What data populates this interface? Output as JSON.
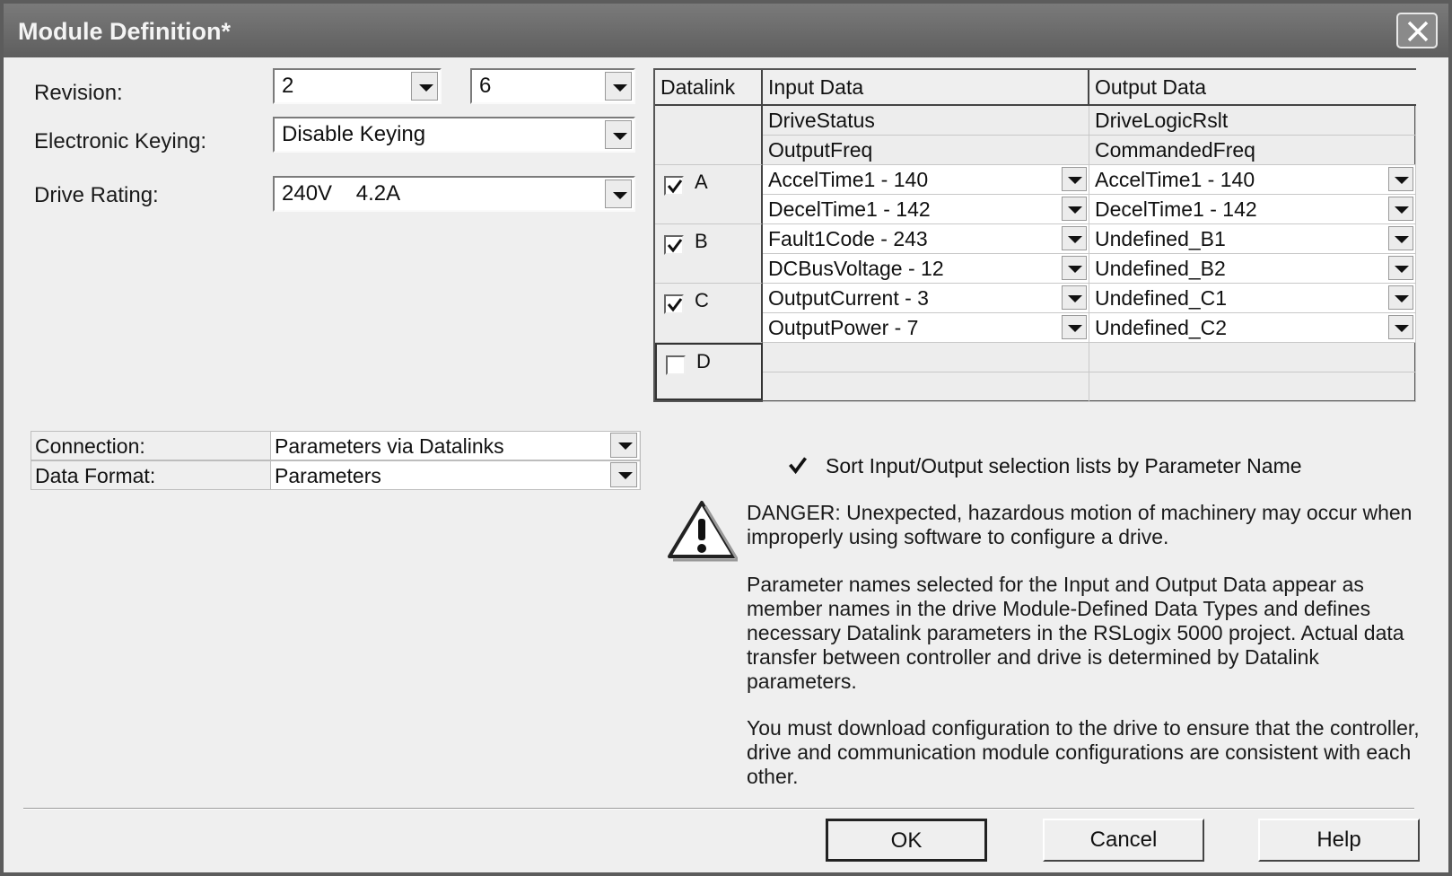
{
  "window": {
    "title": "Module Definition*"
  },
  "revision": {
    "label": "Revision:",
    "major": "2",
    "minor": "6"
  },
  "keying": {
    "label": "Electronic Keying:",
    "value": "Disable Keying"
  },
  "drive_rating": {
    "label": "Drive Rating:",
    "value": "240V    4.2A"
  },
  "grid": {
    "headers": {
      "datalink": "Datalink",
      "input": "Input Data",
      "output": "Output Data"
    },
    "fixed_rows": [
      {
        "input": "DriveStatus",
        "output": "DriveLogicRslt"
      },
      {
        "input": "OutputFreq",
        "output": "CommandedFreq"
      }
    ],
    "datalinks": [
      {
        "letter": "A",
        "checked": true,
        "rows": [
          {
            "input": "AccelTime1 - 140",
            "output": "AccelTime1 - 140"
          },
          {
            "input": "DecelTime1 - 142",
            "output": "DecelTime1 - 142"
          }
        ]
      },
      {
        "letter": "B",
        "checked": true,
        "rows": [
          {
            "input": "Fault1Code - 243",
            "output": "Undefined_B1"
          },
          {
            "input": "DCBusVoltage - 12",
            "output": "Undefined_B2"
          }
        ]
      },
      {
        "letter": "C",
        "checked": true,
        "rows": [
          {
            "input": "OutputCurrent - 3",
            "output": "Undefined_C1"
          },
          {
            "input": "OutputPower - 7",
            "output": "Undefined_C2"
          }
        ]
      },
      {
        "letter": "D",
        "checked": false,
        "rows": []
      }
    ]
  },
  "connection": {
    "label": "Connection:",
    "value": "Parameters via Datalinks"
  },
  "data_format": {
    "label": "Data Format:",
    "value": "Parameters"
  },
  "sort_option": {
    "label": "Sort Input/Output selection lists by Parameter Name",
    "checked": true
  },
  "danger": {
    "text": "DANGER: Unexpected, hazardous motion of machinery may occur when improperly using software to configure a drive."
  },
  "info1": "Parameter names selected for the Input and Output Data appear as member names in the drive Module-Defined Data Types and defines necessary Datalink parameters in the RSLogix 5000 project. Actual data transfer between controller and drive is determined by Datalink parameters.",
  "info2": "You must download configuration to the drive to ensure that the controller, drive and communication module configurations are consistent with each other.",
  "buttons": {
    "ok": "OK",
    "cancel": "Cancel",
    "help": "Help"
  }
}
